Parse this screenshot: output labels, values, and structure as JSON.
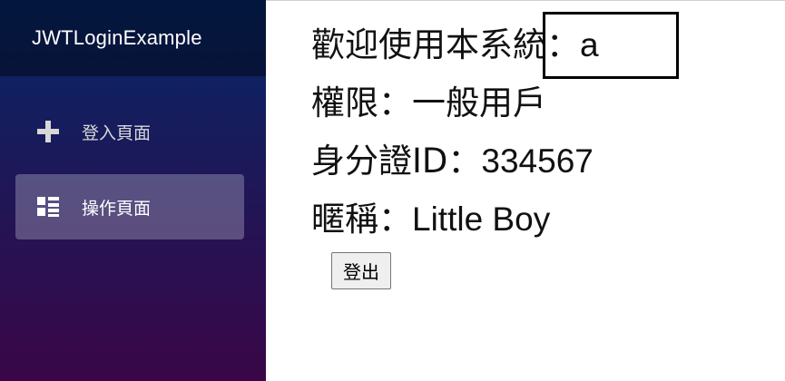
{
  "app": {
    "brand": "JWTLoginExample"
  },
  "sidebar": {
    "items": [
      {
        "label": "登入頁面",
        "icon": "plus-icon",
        "active": false
      },
      {
        "label": "操作頁面",
        "icon": "list-icon",
        "active": true
      }
    ]
  },
  "main": {
    "welcome_label": "歡迎使用本系統：",
    "welcome_value": "a",
    "permission_label": "權限：",
    "permission_value": "一般用戶",
    "id_label": "身分證ID：",
    "id_value": "334567",
    "nickname_label": "暱稱：",
    "nickname_value": "Little Boy",
    "logout_label": "登出"
  },
  "colors": {
    "sidebar_top": "#052767",
    "sidebar_bottom": "#3a0647",
    "active_item": "rgba(255,255,255,0.25)"
  }
}
